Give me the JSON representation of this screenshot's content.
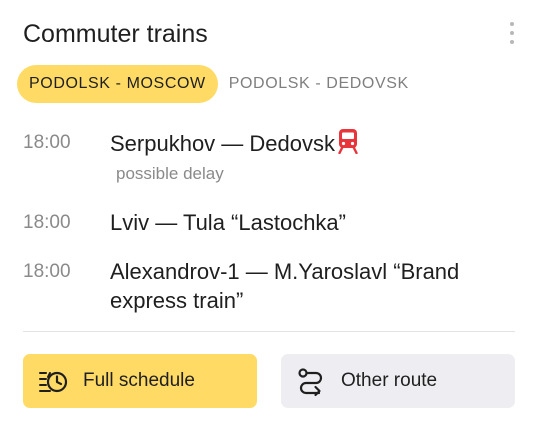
{
  "widget": {
    "title": "Commuter trains",
    "menu_icon": "kebab-menu-icon"
  },
  "tabs": [
    {
      "label": "PODOLSK - MOSCOW",
      "active": true
    },
    {
      "label": "PODOLSK - DEDOVSK",
      "active": false
    }
  ],
  "trains": [
    {
      "time": "18:00",
      "route": "Serpukhov — Dedovsk",
      "icon": "train-icon",
      "note": "possible delay"
    },
    {
      "time": "18:00",
      "route": "Lviv — Tula “Lastochka”"
    },
    {
      "time": "18:00",
      "route": "Alexandrov-1 — M.Yaroslavl “Brand express train”"
    }
  ],
  "buttons": {
    "full_schedule": {
      "label": "Full schedule",
      "icon": "schedule-clock-icon"
    },
    "other_route": {
      "label": "Other route",
      "icon": "route-switch-icon"
    }
  },
  "colors": {
    "accent": "#ffdb66",
    "alert": "#e8353b",
    "secondary_button": "#eeeef2",
    "muted_text": "#8a8a8a"
  }
}
